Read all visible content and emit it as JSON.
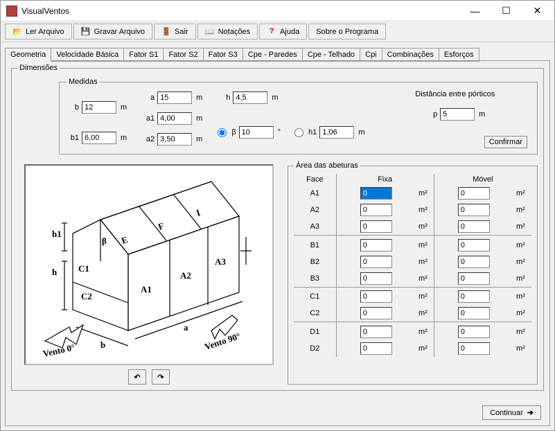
{
  "window": {
    "title": "VisualVentos"
  },
  "toolbar": {
    "ler": "Ler Arquivo",
    "gravar": "Gravar Arquivo",
    "sair": "Sair",
    "notacoes": "Notações",
    "ajuda": "Ajuda",
    "sobre": "Sobre o Programa"
  },
  "tabs": {
    "geometria": "Geometria",
    "velocidade": "Velocidade Básica",
    "s1": "Fator S1",
    "s2": "Fator S2",
    "s3": "Fator S3",
    "cpe_paredes": "Cpe - Paredes",
    "cpe_telhado": "Cpe - Telhado",
    "cpi": "Cpi",
    "combinacoes": "Combinações",
    "esforcos": "Esforços"
  },
  "dimensoes": {
    "legend": "Dimensões",
    "medidas_legend": "Medidas",
    "b_label": "b",
    "b_value": "12",
    "b_unit": "m",
    "b1_label": "b1",
    "b1_value": "6,00",
    "b1_unit": "m",
    "a_label": "a",
    "a_value": "15",
    "a_unit": "m",
    "a1_label": "a1",
    "a1_value": "4,00",
    "a1_unit": "m",
    "a2_label": "a2",
    "a2_value": "3,50",
    "a2_unit": "m",
    "h_label": "h",
    "h_value": "4,5",
    "h_unit": "m",
    "beta_label": "β",
    "beta_value": "10",
    "beta_unit": "°",
    "h1_label": "h1",
    "h1_value": "1,06",
    "h1_unit": "m",
    "dist_label": "Distância entre pórticos",
    "p_label": "p",
    "p_value": "5",
    "p_unit": "m",
    "confirmar": "Confirmar"
  },
  "diagram": {
    "vento0": "Vento 0°",
    "vento90": "Vento 90°",
    "A1": "A1",
    "A2": "A2",
    "A3": "A3",
    "E": "E",
    "F": "F",
    "I": "I",
    "C1": "C1",
    "C2": "C2",
    "h": "h",
    "h1": "h1",
    "beta": "β",
    "a": "a",
    "b": "b"
  },
  "aberturas": {
    "legend": "Área das abeturas",
    "face": "Face",
    "fixa": "Fixa",
    "movel": "Móvel",
    "unit": "m²",
    "rows": [
      {
        "face": "A1",
        "fixa": "0",
        "movel": "0",
        "group": 1
      },
      {
        "face": "A2",
        "fixa": "0",
        "movel": "0",
        "group": 1
      },
      {
        "face": "A3",
        "fixa": "0",
        "movel": "0",
        "group": 1
      },
      {
        "face": "B1",
        "fixa": "0",
        "movel": "0",
        "group": 2
      },
      {
        "face": "B2",
        "fixa": "0",
        "movel": "0",
        "group": 2
      },
      {
        "face": "B3",
        "fixa": "0",
        "movel": "0",
        "group": 2
      },
      {
        "face": "C1",
        "fixa": "0",
        "movel": "0",
        "group": 3
      },
      {
        "face": "C2",
        "fixa": "0",
        "movel": "0",
        "group": 3
      },
      {
        "face": "D1",
        "fixa": "0",
        "movel": "0",
        "group": 4
      },
      {
        "face": "D2",
        "fixa": "0",
        "movel": "0",
        "group": 4
      }
    ]
  },
  "continuar": "Continuar"
}
